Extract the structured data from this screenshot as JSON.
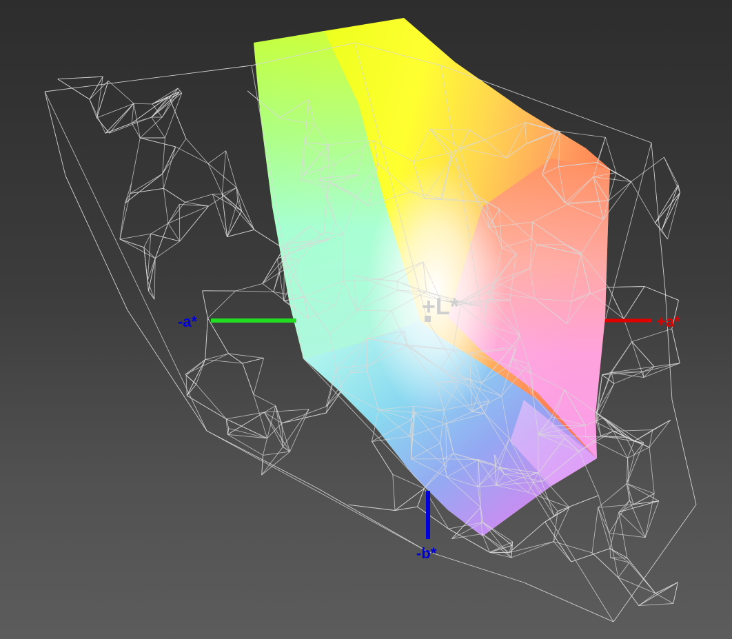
{
  "axes": {
    "l_label": "+L*",
    "a_pos_label": "+a*",
    "a_neg_label": "-a*",
    "b_neg_label": "-b*"
  },
  "colors": {
    "a_pos": "#e00000",
    "a_neg": "#22dd22",
    "b_neg": "#0000dd",
    "l_axis": "#cfcfcf",
    "wire": "#d9d9d9"
  }
}
